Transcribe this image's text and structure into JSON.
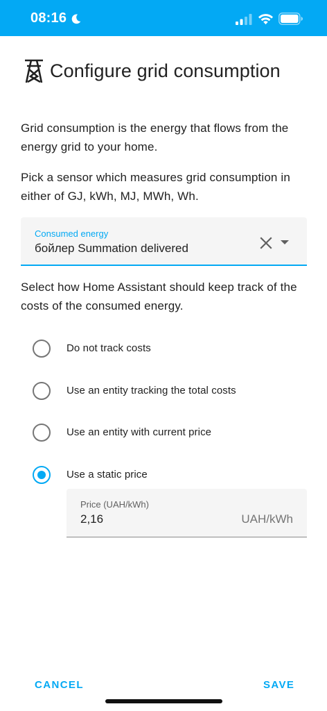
{
  "status_bar": {
    "time": "08:16",
    "icons": [
      "moon-icon",
      "signal-icon",
      "wifi-icon",
      "battery-icon"
    ]
  },
  "dialog": {
    "title": "Configure grid consumption",
    "icon": "transmission-tower-icon",
    "description_1": "Grid consumption is the energy that flows from the energy grid to your home.",
    "description_2": "Pick a sensor which measures grid consumption in either of GJ, kWh, MJ, MWh, Wh.",
    "sensor_field": {
      "label": "Consumed energy",
      "value": "бойлер Summation delivered"
    },
    "cost_description": "Select how Home Assistant should keep track of the costs of the consumed energy.",
    "cost_options": [
      {
        "label": "Do not track costs",
        "selected": false
      },
      {
        "label": "Use an entity tracking the total costs",
        "selected": false
      },
      {
        "label": "Use an entity with current price",
        "selected": false
      },
      {
        "label": "Use a static price",
        "selected": true
      }
    ],
    "price_field": {
      "label": "Price (UAH/kWh)",
      "value": "2,16",
      "suffix": "UAH/kWh"
    },
    "cancel_label": "CANCEL",
    "save_label": "SAVE"
  },
  "colors": {
    "accent": "#03a9f4",
    "text": "#212121",
    "field_background": "#f5f5f5"
  }
}
